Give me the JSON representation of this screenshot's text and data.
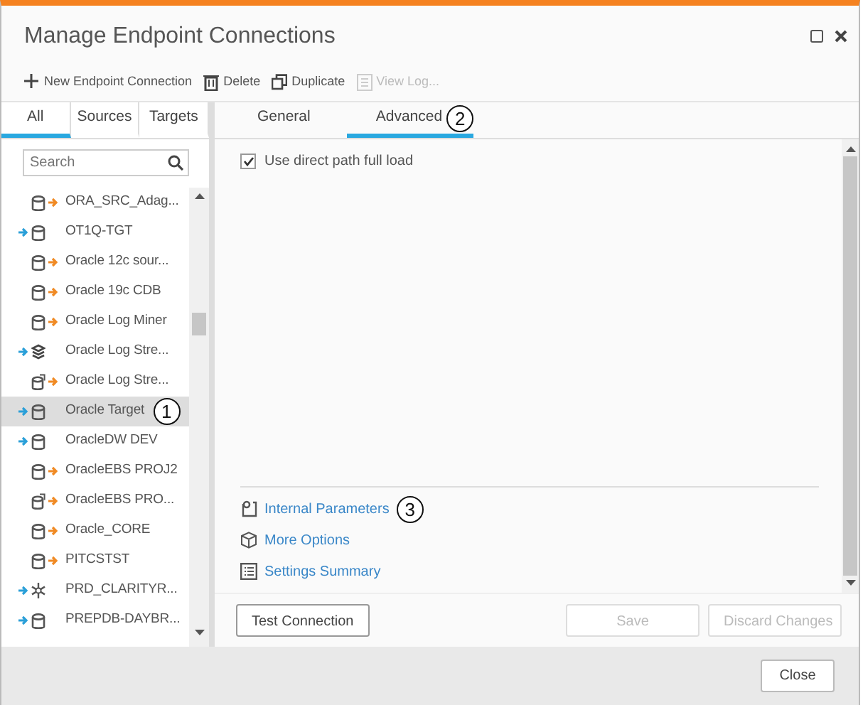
{
  "window": {
    "title": "Manage Endpoint Connections"
  },
  "toolbar": [
    {
      "label": "New Endpoint Connection",
      "disabled": false
    },
    {
      "label": "Delete",
      "disabled": false
    },
    {
      "label": "Duplicate",
      "disabled": false
    },
    {
      "label": "View Log...",
      "disabled": true
    }
  ],
  "list_tabs": [
    {
      "label": "All",
      "selected": true
    },
    {
      "label": "Sources",
      "selected": false
    },
    {
      "label": "Targets",
      "selected": false
    }
  ],
  "search": {
    "placeholder": "Search"
  },
  "endpoints": [
    {
      "name": "ORA_SRC_Adag...",
      "kind": "dbsource",
      "selected": false
    },
    {
      "name": "OT1Q-TGT",
      "kind": "dbtarget",
      "selected": false
    },
    {
      "name": "Oracle 12c sour...",
      "kind": "dbsource",
      "selected": false
    },
    {
      "name": "Oracle 19c CDB",
      "kind": "dbsource",
      "selected": false
    },
    {
      "name": "Oracle Log Miner",
      "kind": "dbsource",
      "selected": false
    },
    {
      "name": "Oracle Log Stre...",
      "kind": "stacktarget",
      "selected": false
    },
    {
      "name": "Oracle Log Stre...",
      "kind": "docsource",
      "selected": false
    },
    {
      "name": "Oracle Target",
      "kind": "dbtarget",
      "selected": true,
      "callout": "1"
    },
    {
      "name": "OracleDW DEV",
      "kind": "dbtarget",
      "selected": false
    },
    {
      "name": "OracleEBS PROJ2",
      "kind": "dbsource",
      "selected": false
    },
    {
      "name": "OracleEBS PRO...",
      "kind": "docsource",
      "selected": false
    },
    {
      "name": "Oracle_CORE",
      "kind": "dbsource",
      "selected": false
    },
    {
      "name": "PITCSTST",
      "kind": "dbsource",
      "selected": false
    },
    {
      "name": "PRD_CLARITYR...",
      "kind": "snowtarget",
      "selected": false
    },
    {
      "name": "PREPDB-DAYBR...",
      "kind": "dbtarget",
      "selected": false
    }
  ],
  "detail_tabs": [
    {
      "label": "General",
      "selected": false
    },
    {
      "label": "Advanced",
      "selected": true,
      "callout": "2"
    }
  ],
  "options": [
    {
      "label": "Use direct path full load",
      "checked": true
    }
  ],
  "links": [
    {
      "label": "Internal Parameters",
      "callout": "3"
    },
    {
      "label": "More Options"
    },
    {
      "label": "Settings Summary"
    }
  ],
  "actions": [
    {
      "label": "Test Connection",
      "disabled": false
    },
    {
      "label": "Save",
      "disabled": true
    },
    {
      "label": "Discard Changes",
      "disabled": true
    }
  ],
  "footer_buttons": [
    "Close"
  ]
}
